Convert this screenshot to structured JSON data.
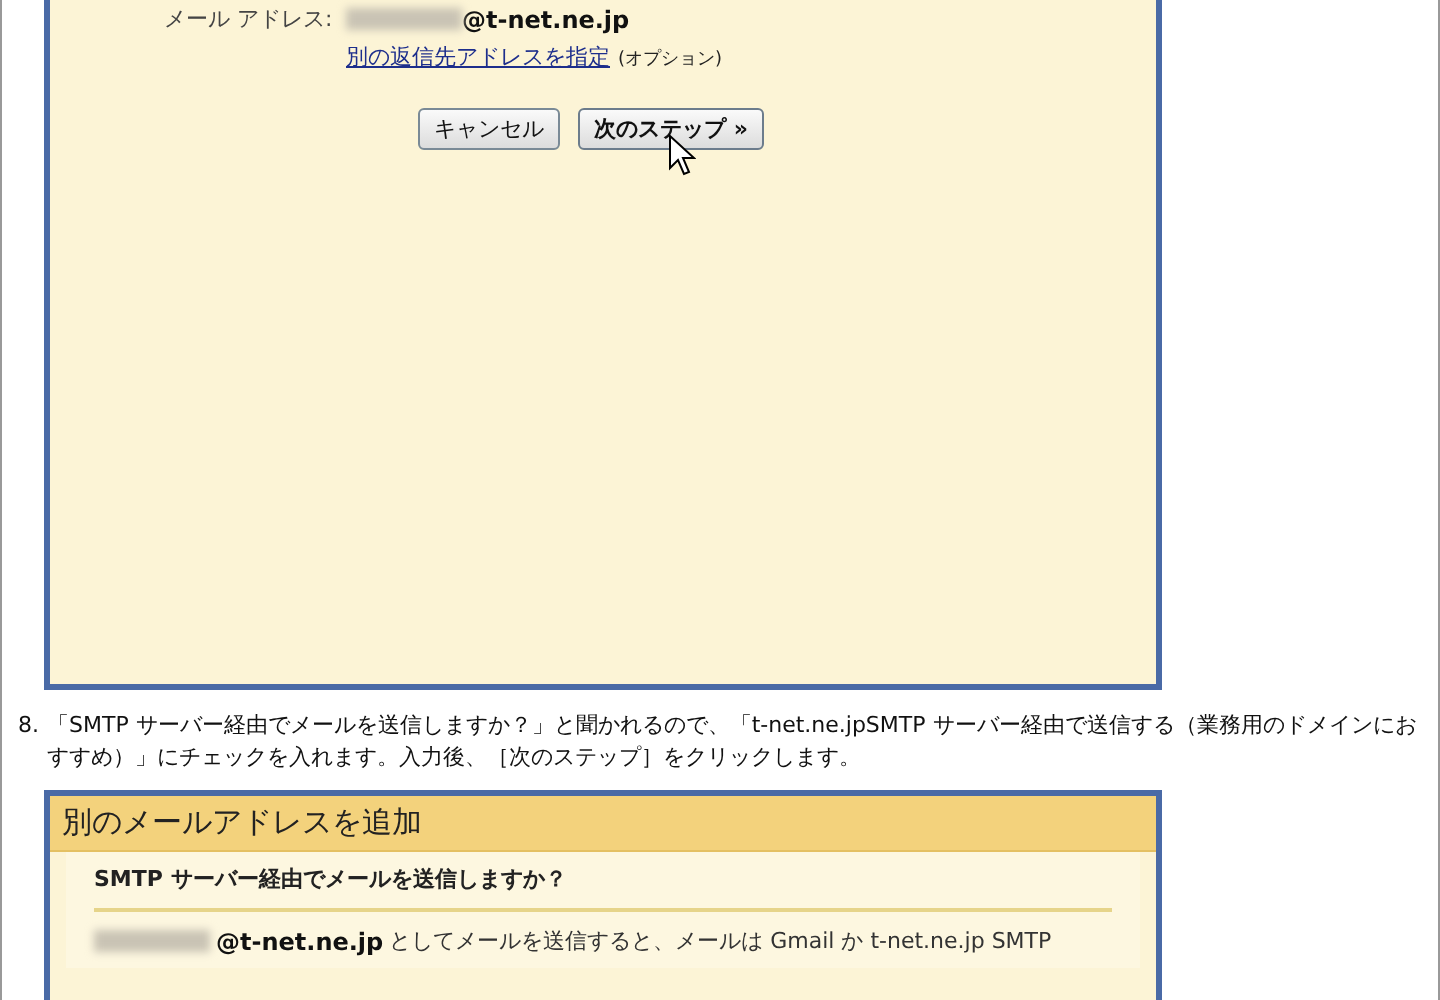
{
  "dialog_top": {
    "email_label": "メール アドレス:",
    "email_domain": "@t-net.ne.jp",
    "reply_link": "別の返信先アドレスを指定",
    "reply_note": "(オプション)",
    "buttons": [
      {
        "label": "キャンセル",
        "primary": false
      },
      {
        "label": "次のステップ »",
        "primary": true
      }
    ]
  },
  "step": {
    "number": "8.",
    "text": "「SMTP サーバー経由でメールを送信しますか？」と聞かれるので、「t-net.ne.jpSMTP サーバー経由で送信する（業務用のドメインにおすすめ）」にチェックを入れます。入力後、［次のステップ］をクリックします。"
  },
  "dialog_bottom": {
    "title": "別のメールアドレスを追加",
    "question": "SMTP サーバー経由でメールを送信しますか？",
    "email_domain": "@t-net.ne.jp",
    "body": "としてメールを送信すると、メールは Gmail か t-net.ne.jp SMTP"
  }
}
